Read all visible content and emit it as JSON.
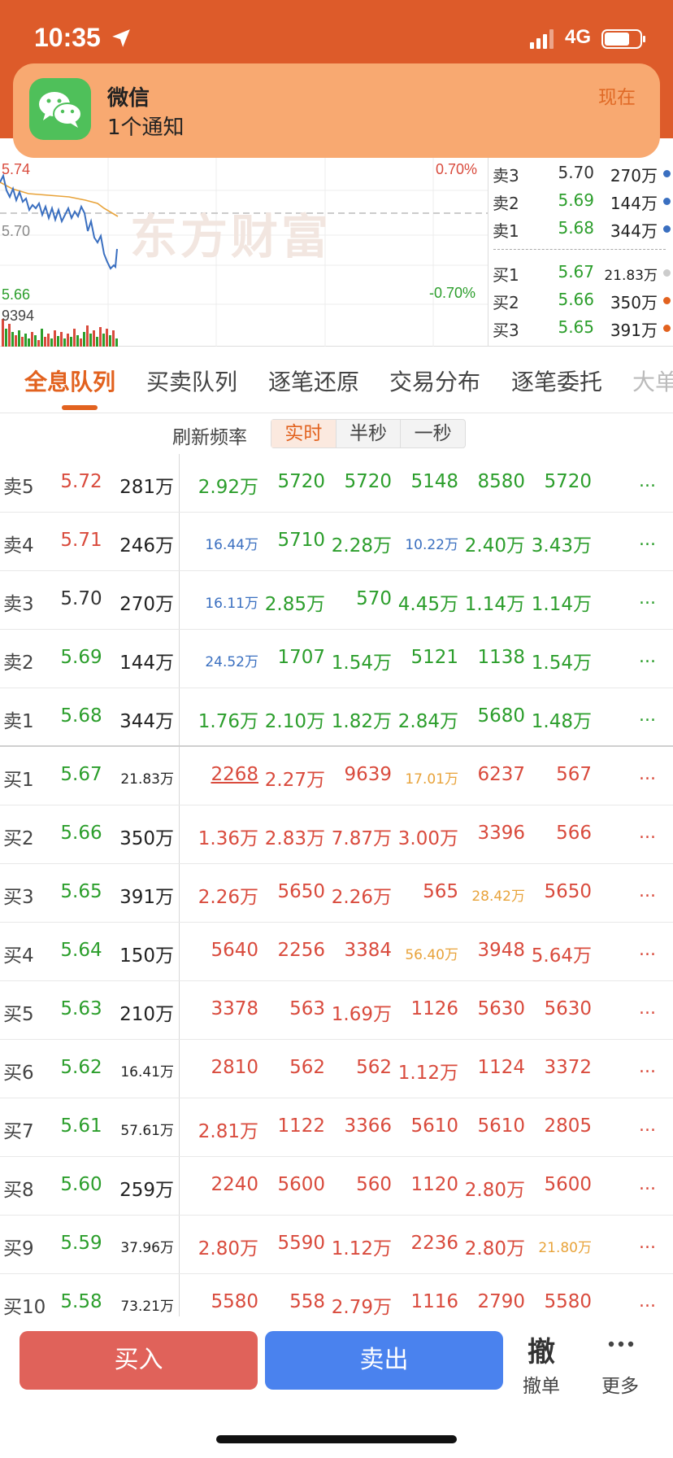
{
  "status_bar": {
    "time": "10:35",
    "network": "4G"
  },
  "notification": {
    "app": "微信",
    "body": "1个通知",
    "time": "现在"
  },
  "chart": {
    "price_high": "5.74",
    "price_mid": "5.70",
    "price_low": "5.66",
    "pct_high": "0.70%",
    "pct_low": "-0.70%",
    "volume": "9394",
    "watermark": "东方财富"
  },
  "order_book": {
    "asks": [
      {
        "label": "卖3",
        "price": "5.70",
        "vol": "270万"
      },
      {
        "label": "卖2",
        "price": "5.69",
        "vol": "144万"
      },
      {
        "label": "卖1",
        "price": "5.68",
        "vol": "344万"
      }
    ],
    "bids": [
      {
        "label": "买1",
        "price": "5.67",
        "vol": "21.83万"
      },
      {
        "label": "买2",
        "price": "5.66",
        "vol": "350万"
      },
      {
        "label": "买3",
        "price": "5.65",
        "vol": "391万"
      }
    ]
  },
  "tabs": [
    "全息队列",
    "买卖队列",
    "逐笔还原",
    "交易分布",
    "逐笔委托",
    "大单"
  ],
  "refresh": {
    "label": "刷新频率",
    "options": [
      "实时",
      "半秒",
      "一秒"
    ]
  },
  "queue_rows": [
    {
      "name": "卖5",
      "price": "5.72",
      "vol": "281万",
      "cells": [
        "2.92万",
        "5720",
        "5720",
        "5148",
        "8580",
        "5720"
      ]
    },
    {
      "name": "卖4",
      "price": "5.71",
      "vol": "246万",
      "cells": [
        "16.44万",
        "5710",
        "2.28万",
        "10.22万",
        "2.40万",
        "3.43万"
      ]
    },
    {
      "name": "卖3",
      "price": "5.70",
      "vol": "270万",
      "cells": [
        "16.11万",
        "2.85万",
        "570",
        "4.45万",
        "1.14万",
        "1.14万"
      ]
    },
    {
      "name": "卖2",
      "price": "5.69",
      "vol": "144万",
      "cells": [
        "24.52万",
        "1707",
        "1.54万",
        "5121",
        "1138",
        "1.54万"
      ]
    },
    {
      "name": "卖1",
      "price": "5.68",
      "vol": "344万",
      "cells": [
        "1.76万",
        "2.10万",
        "1.82万",
        "2.84万",
        "5680",
        "1.48万"
      ]
    },
    {
      "name": "买1",
      "price": "5.67",
      "vol": "21.83万",
      "cells": [
        "2268",
        "2.27万",
        "9639",
        "17.01万",
        "6237",
        "567"
      ]
    },
    {
      "name": "买2",
      "price": "5.66",
      "vol": "350万",
      "cells": [
        "1.36万",
        "2.83万",
        "7.87万",
        "3.00万",
        "3396",
        "566"
      ]
    },
    {
      "name": "买3",
      "price": "5.65",
      "vol": "391万",
      "cells": [
        "2.26万",
        "5650",
        "2.26万",
        "565",
        "28.42万",
        "5650"
      ]
    },
    {
      "name": "买4",
      "price": "5.64",
      "vol": "150万",
      "cells": [
        "5640",
        "2256",
        "3384",
        "56.40万",
        "3948",
        "5.64万"
      ]
    },
    {
      "name": "买5",
      "price": "5.63",
      "vol": "210万",
      "cells": [
        "3378",
        "563",
        "1.69万",
        "1126",
        "5630",
        "5630"
      ]
    },
    {
      "name": "买6",
      "price": "5.62",
      "vol": "16.41万",
      "cells": [
        "2810",
        "562",
        "562",
        "1.12万",
        "1124",
        "3372"
      ]
    },
    {
      "name": "买7",
      "price": "5.61",
      "vol": "57.61万",
      "cells": [
        "2.81万",
        "1122",
        "3366",
        "5610",
        "5610",
        "2805"
      ]
    },
    {
      "name": "买8",
      "price": "5.60",
      "vol": "259万",
      "cells": [
        "2240",
        "5600",
        "560",
        "1120",
        "2.80万",
        "5600"
      ]
    },
    {
      "name": "买9",
      "price": "5.59",
      "vol": "37.96万",
      "cells": [
        "2.80万",
        "5590",
        "1.12万",
        "2236",
        "2.80万",
        "21.80万"
      ]
    },
    {
      "name": "买10",
      "price": "5.58",
      "vol": "73.21万",
      "cells": [
        "5580",
        "558",
        "2.79万",
        "1116",
        "2790",
        "5580"
      ]
    }
  ],
  "more_glyph": "...",
  "bottom": {
    "buy": "买入",
    "sell": "卖出",
    "cancel_icon": "撤",
    "cancel": "撤单",
    "more": "更多"
  },
  "colors": {
    "accent": "#e2621f",
    "up": "#d94b3d",
    "down": "#2c9e2c",
    "blue": "#3a6fc0",
    "orange": "#e8a33a",
    "buy_btn": "#e0625a",
    "sell_btn": "#4a82ee"
  }
}
